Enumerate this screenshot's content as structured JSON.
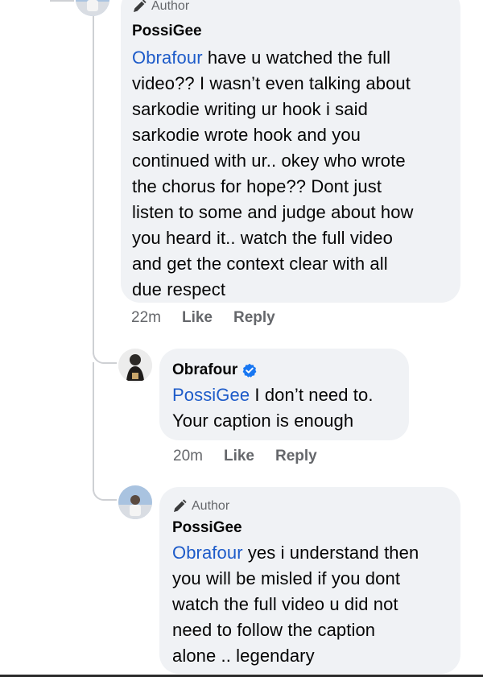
{
  "comments": [
    {
      "author_badge": "Author",
      "name": "PossiGee",
      "mention": "Obrafour",
      "lines": [
        " have u watched the full",
        "video?? I wasn’t even talking about",
        "sarkodie writing ur hook i said",
        "sarkodie wrote hook and you",
        "continued with ur.. okey who wrote",
        "the chorus for hope?? Dont just",
        "listen to some and judge about how",
        "you heard it.. watch the full video",
        "and get the context clear with all",
        "due respect"
      ],
      "time": "22m",
      "like_label": "Like",
      "reply_label": "Reply"
    },
    {
      "name": "Obrafour",
      "verified": true,
      "mention": "PossiGee",
      "lines": [
        " I don’t need to.",
        "Your caption is enough"
      ],
      "time": "20m",
      "like_label": "Like",
      "reply_label": "Reply"
    },
    {
      "author_badge": "Author",
      "name": "PossiGee",
      "mention": "Obrafour",
      "lines": [
        " yes i understand then",
        "you will be misled if you dont",
        "watch the full video u did not",
        "need to follow the caption",
        "alone .. legendary"
      ]
    }
  ],
  "colors": {
    "bubble": "#f0f2f5",
    "mention": "#1d5bc9",
    "meta": "#65676b",
    "verified": "#1877f2"
  }
}
